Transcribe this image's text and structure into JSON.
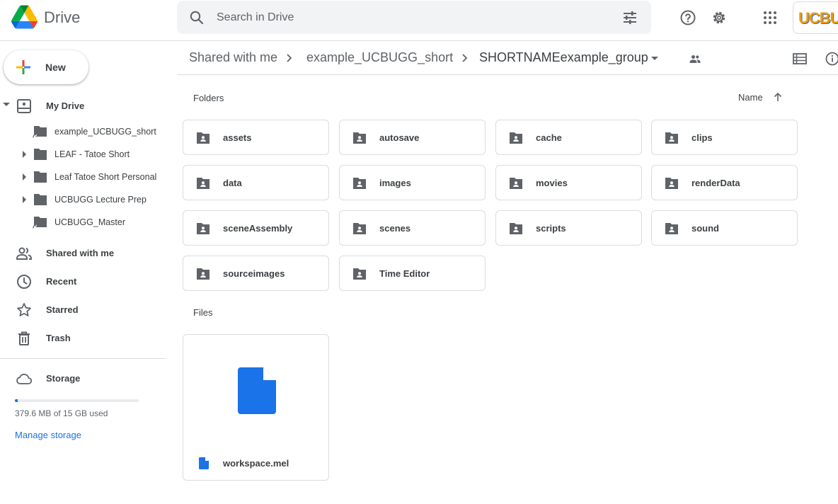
{
  "app": {
    "name": "Drive"
  },
  "search": {
    "placeholder": "Search in Drive"
  },
  "account": {
    "avatar_text": "UCBU"
  },
  "sidebar": {
    "new_label": "New",
    "my_drive": "My Drive",
    "tree": [
      {
        "label": "example_UCBUGG_short",
        "shortcut": true,
        "expandable": false
      },
      {
        "label": "LEAF - Tatoe Short",
        "shortcut": false,
        "expandable": true
      },
      {
        "label": "Leaf Tatoe Short Personal",
        "shortcut": false,
        "expandable": true
      },
      {
        "label": "UCBUGG Lecture Prep",
        "shortcut": false,
        "expandable": true
      },
      {
        "label": "UCBUGG_Master",
        "shortcut": true,
        "expandable": false
      }
    ],
    "items": [
      {
        "label": "Shared with me",
        "icon": "people-icon"
      },
      {
        "label": "Recent",
        "icon": "clock-icon"
      },
      {
        "label": "Starred",
        "icon": "star-icon"
      },
      {
        "label": "Trash",
        "icon": "trash-icon"
      }
    ],
    "storage": {
      "label": "Storage",
      "used_text": "379.6 MB of 15 GB used",
      "used_fraction": 0.025,
      "manage_label": "Manage storage"
    }
  },
  "breadcrumb": {
    "items": [
      "Shared with me",
      "example_UCBUGG_short",
      "SHORTNAMEexample_group"
    ]
  },
  "main": {
    "folders_label": "Folders",
    "sort_label": "Name",
    "files_label": "Files",
    "folders": [
      "assets",
      "autosave",
      "cache",
      "clips",
      "data",
      "images",
      "movies",
      "renderData",
      "sceneAssembly",
      "scenes",
      "scripts",
      "sound",
      "sourceimages",
      "Time Editor"
    ],
    "files": [
      {
        "name": "workspace.mel"
      }
    ]
  },
  "colors": {
    "accent": "#1a73e8",
    "icon_gray": "#5f6368",
    "border": "#dadce0"
  }
}
